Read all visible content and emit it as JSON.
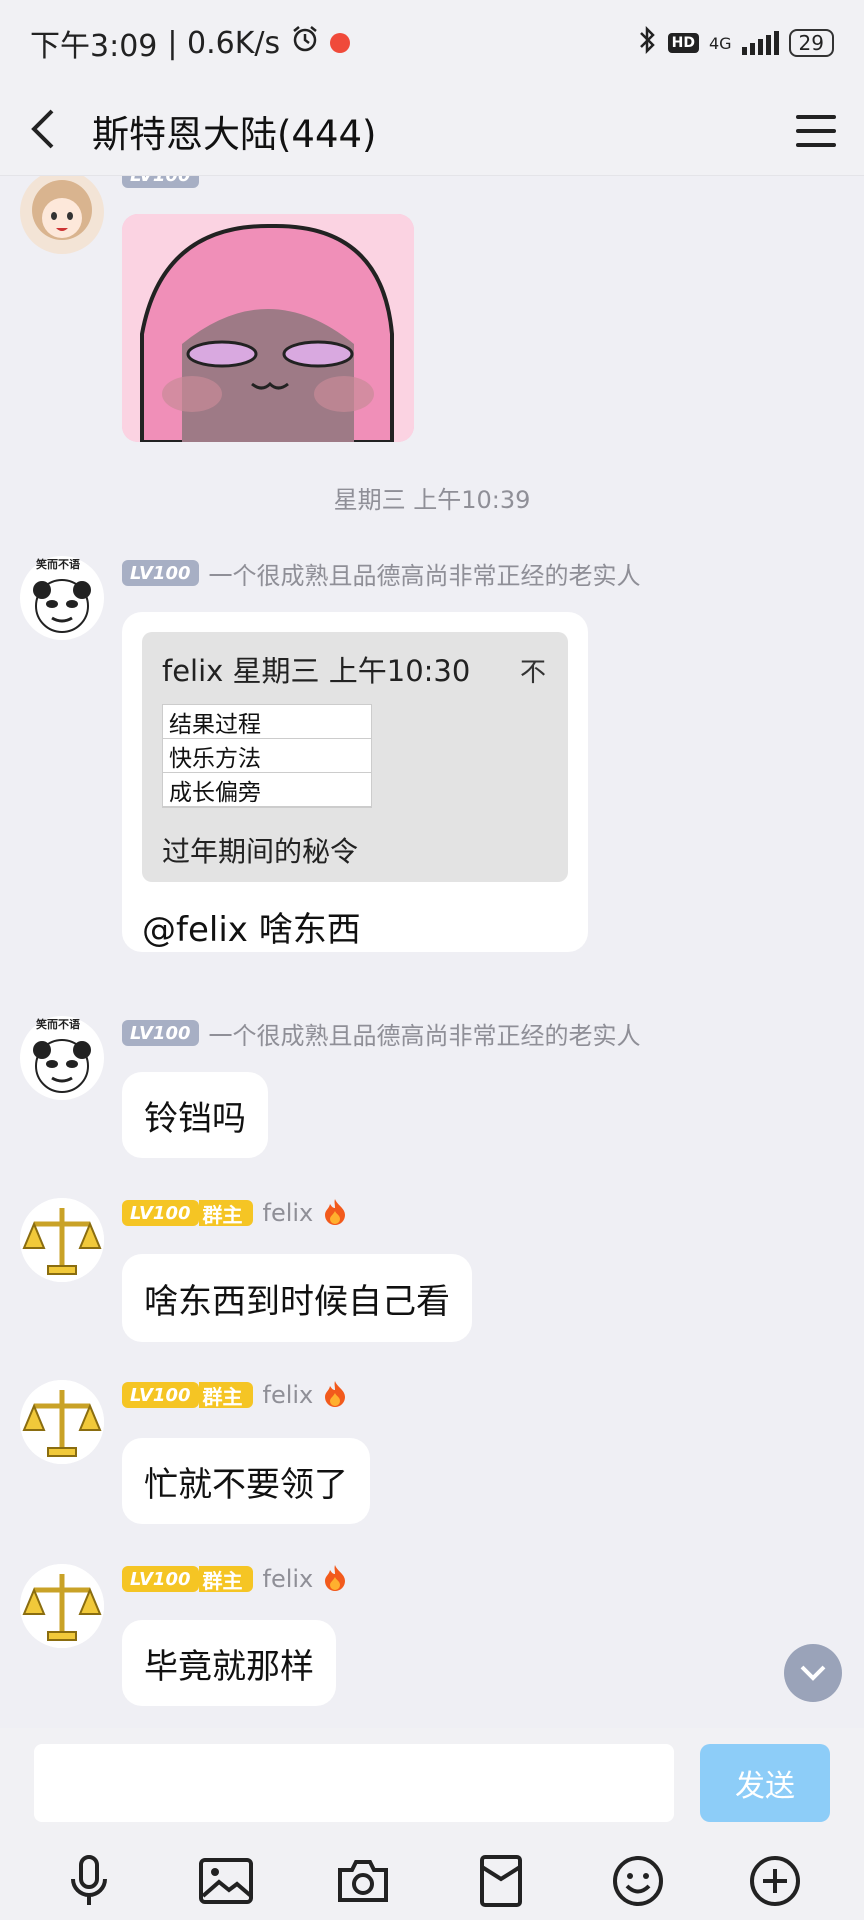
{
  "status_bar": {
    "time": "下午3:09",
    "speed": "| 0.6K/s",
    "network": "4G",
    "hd": "HD",
    "battery": "29"
  },
  "header": {
    "title": "斯特恩大陆(444)"
  },
  "messages": [
    {
      "level": "LV100",
      "nickname": "",
      "type": "image"
    },
    {
      "type": "timestamp",
      "text": "星期三 上午10:39"
    },
    {
      "level": "LV100",
      "nickname": "一个很成熟且品德高尚非常正经的老实人",
      "avatar_caption": "笑而不语",
      "type": "quote_reply",
      "quote": {
        "header": "felix  星期三  上午10:30",
        "pin": "不",
        "table_rows": [
          "结果过程",
          "快乐方法",
          "成长偏旁"
        ],
        "footer": "过年期间的秘令"
      },
      "reply": "@felix 啥东西"
    },
    {
      "level": "LV100",
      "nickname": "一个很成熟且品德高尚非常正经的老实人",
      "avatar_caption": "笑而不语",
      "type": "text",
      "text": "铃铛吗"
    },
    {
      "level": "LV100",
      "role": "群主",
      "nickname": "felix",
      "type": "text",
      "text": "啥东西到时候自己看"
    },
    {
      "level": "LV100",
      "role": "群主",
      "nickname": "felix",
      "type": "text",
      "text": "忙就不要领了"
    },
    {
      "level": "LV100",
      "role": "群主",
      "nickname": "felix",
      "type": "text",
      "text": "毕竟就那样"
    }
  ],
  "input": {
    "value": "",
    "placeholder": "",
    "send_label": "发送"
  },
  "toolbar": {
    "icons": [
      "microphone-icon",
      "image-icon",
      "camera-icon",
      "red-packet-icon",
      "emoji-icon",
      "plus-icon"
    ]
  },
  "colors": {
    "background": "#efeff4",
    "level_badge": "#a7afc4",
    "owner_badge": "#f5c524",
    "send_button": "#8dcdf8"
  }
}
